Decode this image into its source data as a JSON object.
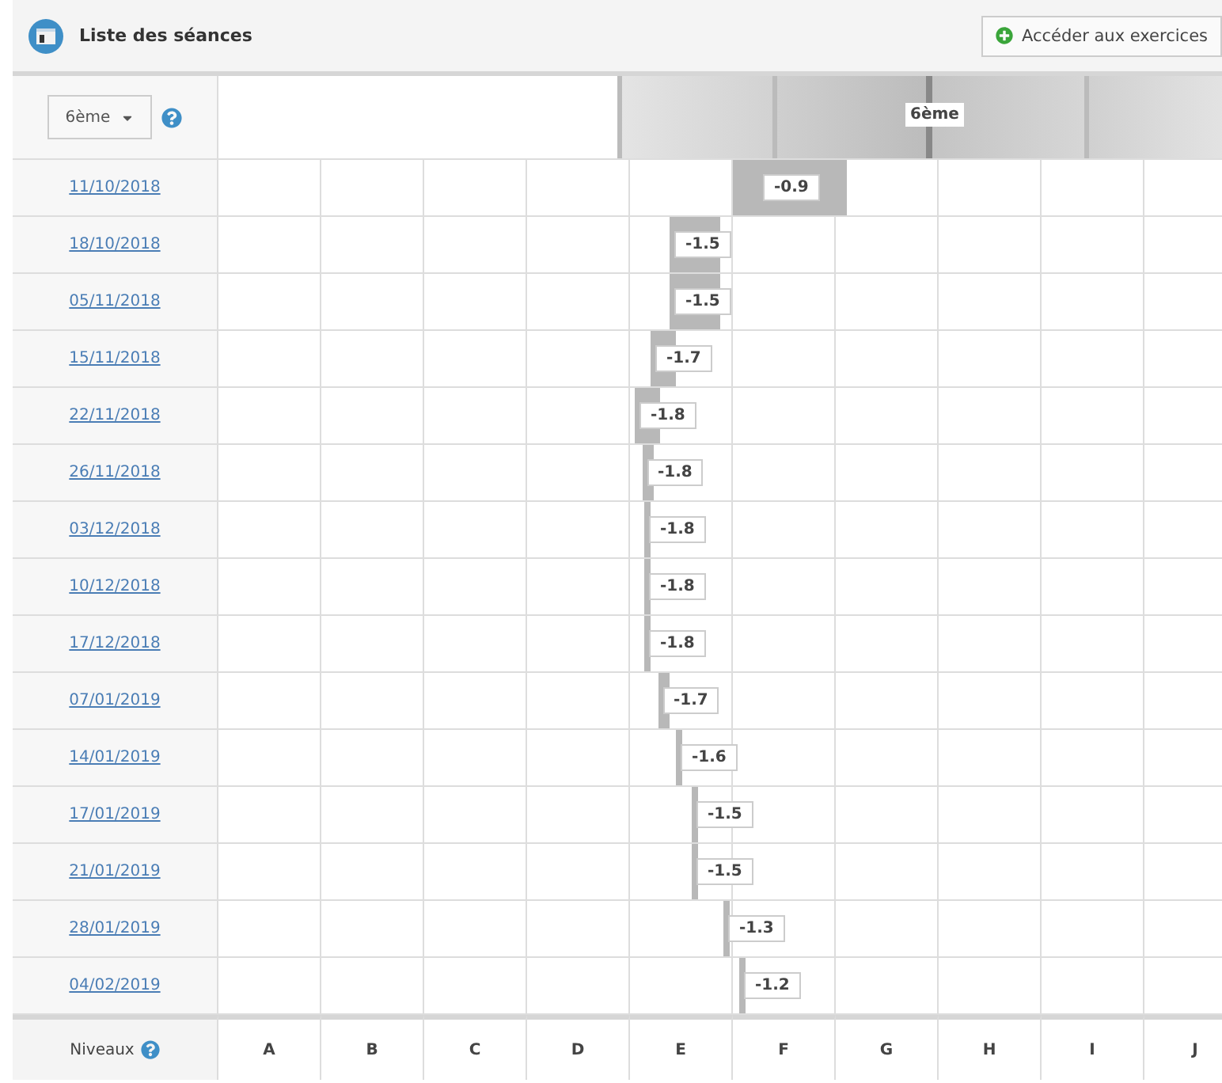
{
  "header": {
    "title": "Liste des séances",
    "button": "Accéder aux exercices"
  },
  "band": {
    "selector": "6ème",
    "label": "6ème"
  },
  "rows": [
    {
      "date": "11/10/2018",
      "value": "-0.9",
      "kind": "block"
    },
    {
      "date": "18/10/2018",
      "value": "-1.5",
      "kind": "wide"
    },
    {
      "date": "05/11/2018",
      "value": "-1.5",
      "kind": "wide"
    },
    {
      "date": "15/11/2018",
      "value": "-1.7",
      "kind": "medium"
    },
    {
      "date": "22/11/2018",
      "value": "-1.8",
      "kind": "medium"
    },
    {
      "date": "26/11/2018",
      "value": "-1.8",
      "kind": "small"
    },
    {
      "date": "03/12/2018",
      "value": "-1.8",
      "kind": "narrow"
    },
    {
      "date": "10/12/2018",
      "value": "-1.8",
      "kind": "narrow"
    },
    {
      "date": "17/12/2018",
      "value": "-1.8",
      "kind": "narrow"
    },
    {
      "date": "07/01/2019",
      "value": "-1.7",
      "kind": "small"
    },
    {
      "date": "14/01/2019",
      "value": "-1.6",
      "kind": "narrow"
    },
    {
      "date": "17/01/2019",
      "value": "-1.5",
      "kind": "narrow"
    },
    {
      "date": "21/01/2019",
      "value": "-1.5",
      "kind": "narrow"
    },
    {
      "date": "28/01/2019",
      "value": "-1.3",
      "kind": "narrow"
    },
    {
      "date": "04/02/2019",
      "value": "-1.2",
      "kind": "narrow"
    }
  ],
  "footer": {
    "label": "Niveaux",
    "levels": [
      "A",
      "B",
      "C",
      "D",
      "E",
      "F",
      "G",
      "H",
      "I",
      "J"
    ]
  }
}
